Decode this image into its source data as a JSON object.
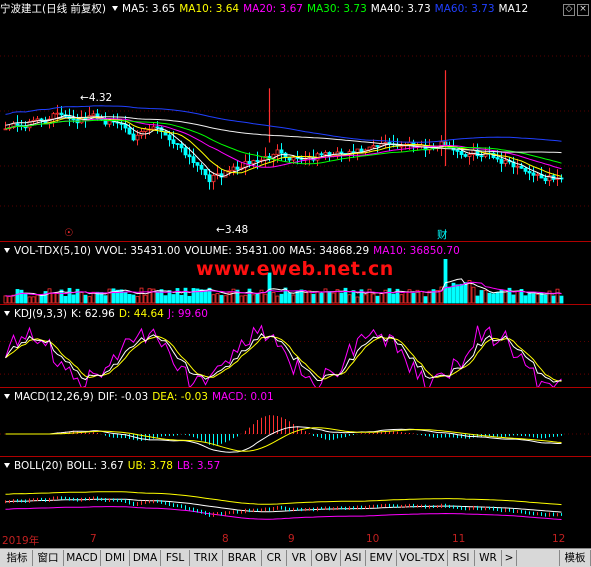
{
  "colors": {
    "up": "#ff3030",
    "down": "#00ffff",
    "ma5": "#ffffff",
    "ma10": "#ffff00",
    "ma20": "#ff00ff",
    "ma30": "#00ff00",
    "ma40": "#ffffff",
    "ma60": "#2040ff",
    "grid": "#b00000"
  },
  "main": {
    "stock": "宁波建工",
    "period": "(日线 前复权)",
    "ma": [
      {
        "label": "MA5:",
        "value": "3.65",
        "color": "#ffffff"
      },
      {
        "label": "MA10:",
        "value": "3.64",
        "color": "#ffff00"
      },
      {
        "label": "MA20:",
        "value": "3.67",
        "color": "#ff00ff"
      },
      {
        "label": "MA30:",
        "value": "3.73",
        "color": "#00ff00"
      },
      {
        "label": "MA40:",
        "value": "3.73",
        "color": "#ffffff"
      },
      {
        "label": "MA60:",
        "value": "3.73",
        "color": "#2040ff"
      },
      {
        "label": "MA12",
        "value": "",
        "color": "#ffffff"
      }
    ],
    "high_label": "4.32",
    "low_label": "3.48",
    "marker_left": "☉",
    "marker_right": "财"
  },
  "vol": {
    "title": "VOL-TDX(5,10)",
    "items": [
      {
        "label": "VVOL:",
        "value": "35431.00",
        "color": "#ffffff"
      },
      {
        "label": "VOLUME:",
        "value": "35431.00",
        "color": "#ffffff"
      },
      {
        "label": "MA5:",
        "value": "34868.29",
        "color": "#ffffff"
      },
      {
        "label": "MA10:",
        "value": "36850.70",
        "color": "#ff00ff"
      }
    ]
  },
  "kdj": {
    "title": "KDJ(9,3,3)",
    "items": [
      {
        "label": "K:",
        "value": "62.96",
        "color": "#ffffff"
      },
      {
        "label": "D:",
        "value": "44.64",
        "color": "#ffff00"
      },
      {
        "label": "J:",
        "value": "99.60",
        "color": "#ff00ff"
      }
    ]
  },
  "macd": {
    "title": "MACD(12,26,9)",
    "items": [
      {
        "label": "DIF:",
        "value": "-0.03",
        "color": "#ffffff"
      },
      {
        "label": "DEA:",
        "value": "-0.03",
        "color": "#ffff00"
      },
      {
        "label": "MACD:",
        "value": "0.01",
        "color": "#ff00ff"
      }
    ]
  },
  "boll": {
    "title": "BOLL(20)",
    "items": [
      {
        "label": "BOLL:",
        "value": "3.67",
        "color": "#ffffff"
      },
      {
        "label": "UB:",
        "value": "3.78",
        "color": "#ffff00"
      },
      {
        "label": "LB:",
        "value": "3.57",
        "color": "#ff00ff"
      }
    ]
  },
  "watermark": "www.eweb.net.cn",
  "xaxis": [
    "2019年",
    "7",
    "8",
    "9",
    "10",
    "11",
    "12"
  ],
  "tabs": [
    "指标",
    "窗口",
    "MACD",
    "DMI",
    "DMA",
    "FSL",
    "TRIX",
    "BRAR",
    "CR",
    "VR",
    "OBV",
    "ASI",
    "EMV",
    "VOL-TDX",
    "RSI",
    "WR",
    ">",
    "模板"
  ]
}
